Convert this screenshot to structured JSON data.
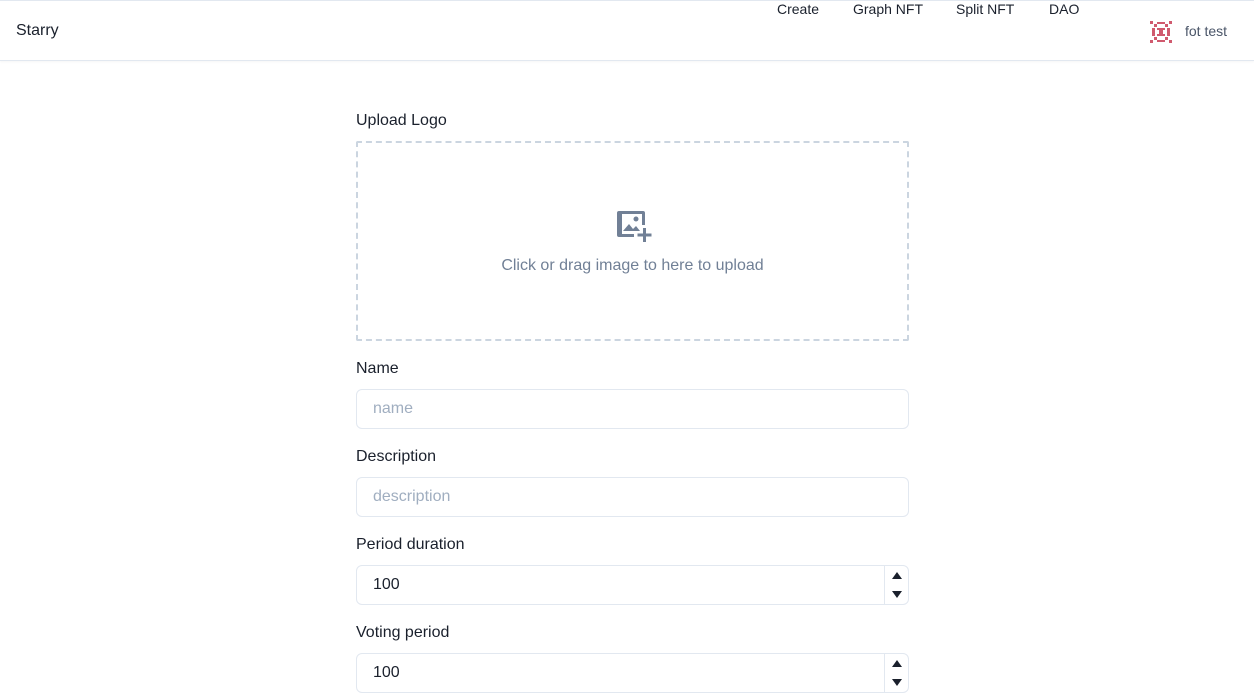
{
  "app": {
    "brand": "Starry"
  },
  "nav": {
    "items": [
      {
        "label": "Create"
      },
      {
        "label": "Graph NFT"
      },
      {
        "label": "Split NFT"
      },
      {
        "label": "DAO"
      }
    ],
    "user": {
      "name": "fot test",
      "avatar_icon": "identicon-avatar",
      "avatar_color": "#d05a6e"
    }
  },
  "form": {
    "logo": {
      "label": "Upload Logo",
      "dropzone_text": "Click or drag image to here to upload",
      "icon": "image-add-icon"
    },
    "name": {
      "label": "Name",
      "placeholder": "name",
      "value": ""
    },
    "description": {
      "label": "Description",
      "placeholder": "description",
      "value": ""
    },
    "period_duration": {
      "label": "Period duration",
      "value": "100"
    },
    "voting_period": {
      "label": "Voting period",
      "value": "100"
    }
  }
}
